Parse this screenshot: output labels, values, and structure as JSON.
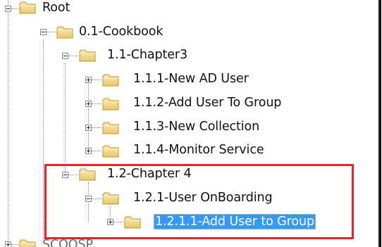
{
  "tree": {
    "root": {
      "label": "Root"
    },
    "cookbook": {
      "label": "0.1-Cookbook"
    },
    "chapter3": {
      "label": "1.1-Chapter3"
    },
    "new_ad_user": {
      "label": "1.1.1-New AD User"
    },
    "add_user_to_group_111": {
      "label": "1.1.2-Add User To Group"
    },
    "new_collection": {
      "label": "1.1.3-New Collection"
    },
    "monitor_service": {
      "label": "1.1.4-Monitor Service"
    },
    "chapter4": {
      "label": "1.2-Chapter 4"
    },
    "user_onboarding": {
      "label": "1.2.1-User OnBoarding"
    },
    "add_user_to_group_1211": {
      "label": "1.2.1.1-Add User to Group",
      "selected": true
    },
    "next_sibling": {
      "label": "SCOOSP"
    }
  },
  "colors": {
    "selection": "#3399ff",
    "highlight_box": "#e8232a",
    "folder_fill": "#f3d98b"
  }
}
